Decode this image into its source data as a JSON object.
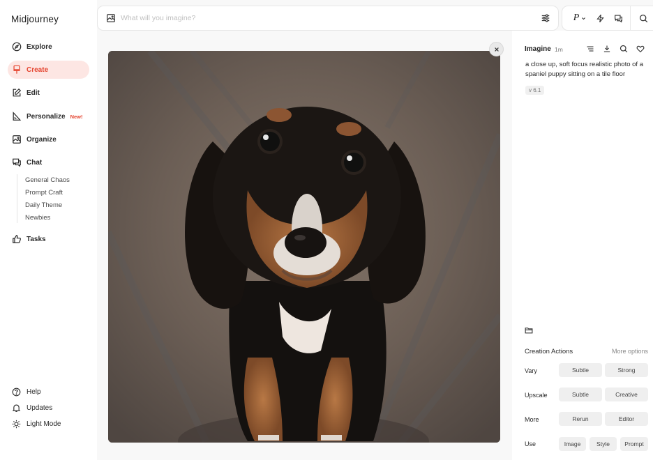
{
  "sidebar": {
    "brand": "Midjourney",
    "items": [
      {
        "label": "Explore",
        "icon": "compass-icon"
      },
      {
        "label": "Create",
        "icon": "paintbrush-icon",
        "active": true
      },
      {
        "label": "Edit",
        "icon": "edit-icon"
      },
      {
        "label": "Personalize",
        "icon": "personalize-icon",
        "badge": "New!"
      },
      {
        "label": "Organize",
        "icon": "image-grid-icon"
      },
      {
        "label": "Chat",
        "icon": "chat-icon"
      }
    ],
    "chat_rooms": [
      "General Chaos",
      "Prompt Craft",
      "Daily Theme",
      "Newbies"
    ],
    "tasks": {
      "label": "Tasks",
      "icon": "thumbs-up-icon"
    },
    "bottom": [
      {
        "label": "Help",
        "icon": "help-icon"
      },
      {
        "label": "Updates",
        "icon": "bell-icon"
      },
      {
        "label": "Light Mode",
        "icon": "sun-icon"
      }
    ]
  },
  "search": {
    "placeholder": "What will you imagine?",
    "value": ""
  },
  "toolbar": {
    "profile_letter": "P"
  },
  "panel": {
    "title": "Imagine",
    "time": "1m",
    "prompt": "a close up, soft focus realistic photo of a spaniel puppy sitting on a tile floor",
    "version": "v 6.1",
    "creation_actions_title": "Creation Actions",
    "more_options": "More options",
    "rows": [
      {
        "label": "Vary",
        "buttons": [
          "Subtle",
          "Strong"
        ]
      },
      {
        "label": "Upscale",
        "buttons": [
          "Subtle",
          "Creative"
        ]
      },
      {
        "label": "More",
        "buttons": [
          "Rerun",
          "Editor"
        ]
      },
      {
        "label": "Use",
        "buttons": [
          "Image",
          "Style",
          "Prompt"
        ]
      }
    ]
  },
  "colors": {
    "accent": "#e5442f",
    "accent_bg": "#fde6e3",
    "button_bg": "#efefef"
  }
}
